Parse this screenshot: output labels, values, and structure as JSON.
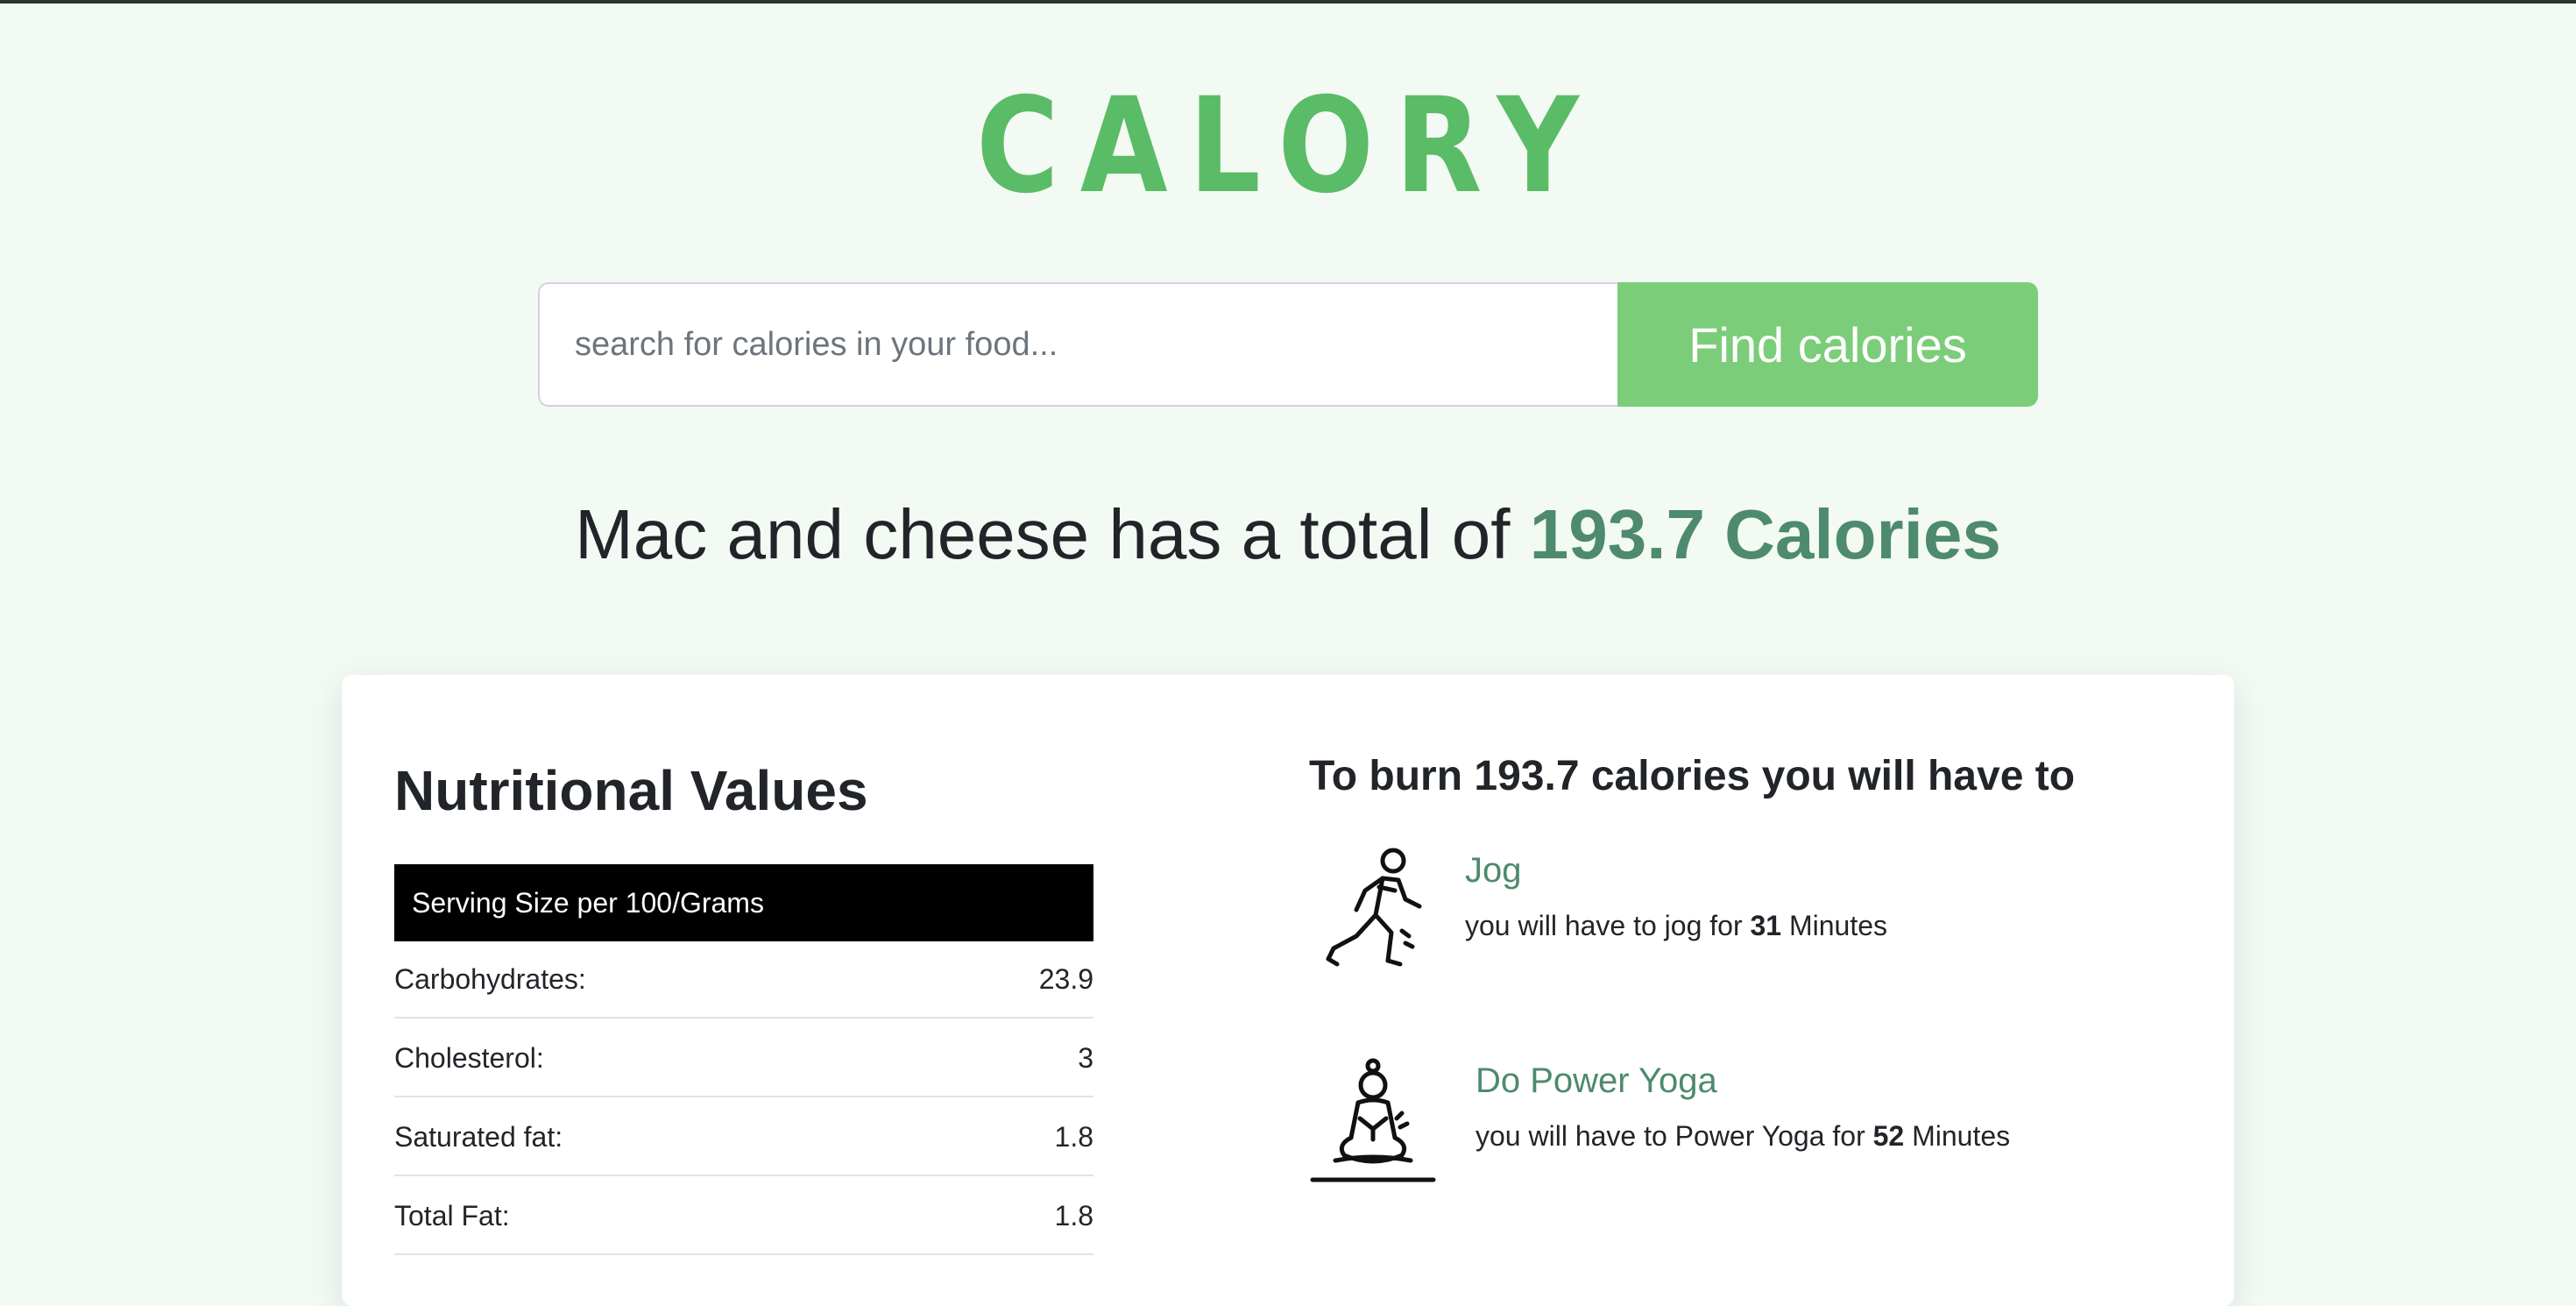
{
  "app": {
    "logo": "CALORY"
  },
  "search": {
    "placeholder": "search for calories in your food...",
    "button_label": "Find calories"
  },
  "result": {
    "food": "Mac and cheese",
    "text": "has a total of",
    "calories": "193.7 Calories"
  },
  "nutrition": {
    "title": "Nutritional Values",
    "serving": "Serving Size per 100/Grams",
    "rows": [
      {
        "label": "Carbohydrates:",
        "value": "23.9"
      },
      {
        "label": "Cholesterol:",
        "value": "3"
      },
      {
        "label": "Saturated fat:",
        "value": "1.8"
      },
      {
        "label": "Total Fat:",
        "value": "1.8"
      }
    ]
  },
  "burn": {
    "title": "To burn 193.7 calories you will have to",
    "activities": [
      {
        "name": "Jog",
        "desc_prefix": "you will have to jog for",
        "minutes": "31",
        "unit": "Minutes",
        "icon": "jogging-icon"
      },
      {
        "name": "Do Power Yoga",
        "desc_prefix": "you will have to Power Yoga for",
        "minutes": "52",
        "unit": "Minutes",
        "icon": "yoga-icon"
      }
    ]
  },
  "colors": {
    "background": "#f3f9f3",
    "logo": "#5abc66",
    "button": "#7bcd79",
    "accent": "#4e8a6d"
  }
}
